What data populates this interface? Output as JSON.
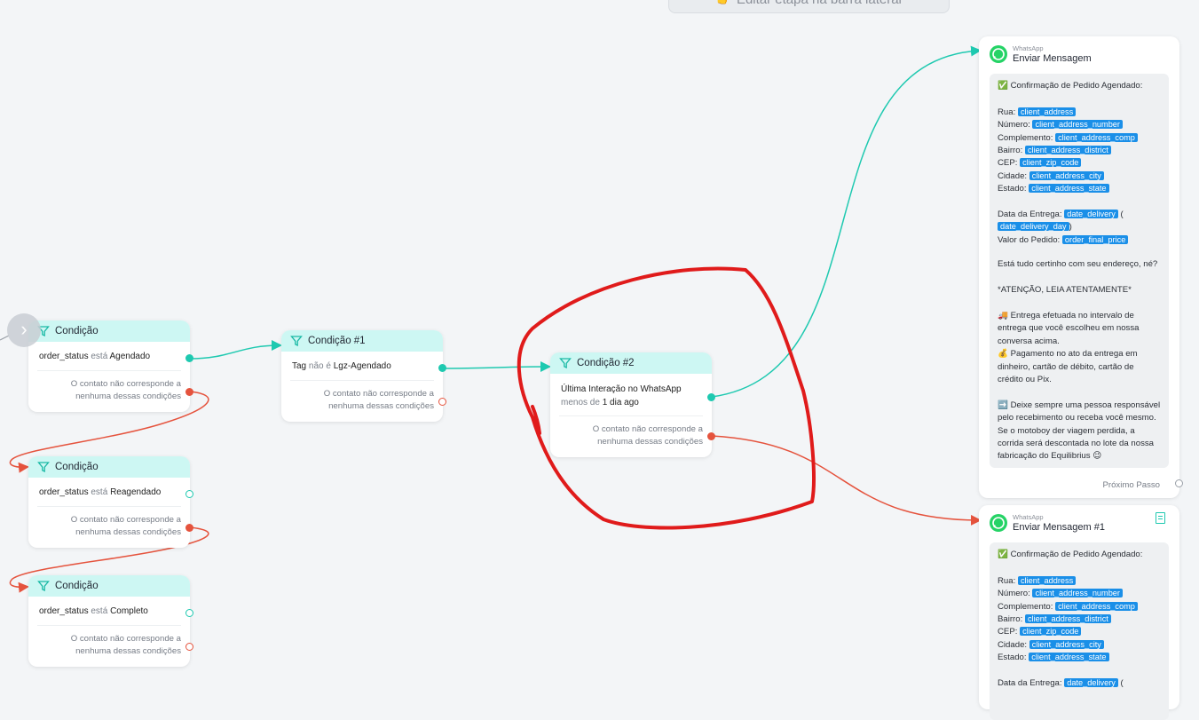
{
  "top_hint": "👉 Editar etapa na barra lateral",
  "nav_arrow": "›",
  "conditions": [
    {
      "title": "Condição",
      "field": "order_status",
      "op": "está",
      "value": "Agendado",
      "else_text": "O contato não corresponde a nenhuma dessas condições"
    },
    {
      "title": "Condição",
      "field": "order_status",
      "op": "está",
      "value": "Reagendado",
      "else_text": "O contato não corresponde a nenhuma dessas condições"
    },
    {
      "title": "Condição",
      "field": "order_status",
      "op": "está",
      "value": "Completo",
      "else_text": "O contato não corresponde a nenhuma dessas condições"
    }
  ],
  "condition1": {
    "title": "Condição #1",
    "field": "Tag",
    "op": "não é",
    "value": "Lgz-Agendado",
    "else_text": "O contato não corresponde a nenhuma dessas condições"
  },
  "condition2": {
    "title": "Condição #2",
    "field": "Última Interação no WhatsApp",
    "op": "menos de",
    "value": "1 dia ago",
    "else_text": "O contato não corresponde a nenhuma dessas condições"
  },
  "wa_cards": [
    {
      "channel": "WhatsApp",
      "title": "Enviar Mensagem",
      "next_step": "Próximo Passo",
      "icon": "whatsapp-icon"
    },
    {
      "channel": "WhatsApp",
      "title": "Enviar Mensagem #1",
      "icon": "whatsapp-icon",
      "action_icon": "notes-icon"
    }
  ],
  "message": {
    "header": "✅ Confirmação de Pedido Agendado:",
    "rua": "Rua:",
    "numero": "Número:",
    "complemento": "Complemento:",
    "bairro": "Bairro:",
    "cep": "CEP:",
    "cidade": "Cidade:",
    "estado": "Estado:",
    "data_entrega": "Data da Entrega:",
    "valor": "Valor do Pedido:",
    "open_paren": "(",
    "close_paren": ")",
    "v_address": "client_address",
    "v_number": "client_address_number",
    "v_comp": "client_address_comp",
    "v_district": "client_address_district",
    "v_zip": "client_zip_code",
    "v_city": "client_address_city",
    "v_state": "client_address_state",
    "v_date": "date_delivery",
    "v_day": "date_delivery_day",
    "v_price": "order_final_price",
    "question": "Está tudo certinho com seu endereço, né?",
    "attention": "*ATENÇÃO, LEIA ATENTAMENTE*",
    "p1_l1": "🚚 Entrega efetuada no intervalo de",
    "p1_l2": "entrega que você escolheu em nossa",
    "p1_l3": "conversa acima.",
    "p2_l1": "💰 Pagamento no ato da entrega em",
    "p2_l2": "dinheiro, cartão de débito, cartão de",
    "p2_l3": "crédito ou Pix.",
    "p3_l1": "➡️ Deixe sempre uma pessoa responsável",
    "p3_l2": "pelo recebimento ou receba você mesmo.",
    "p3_l3": "Se o motoboy der viagem perdida, a",
    "p3_l4": "corrida será descontada no lote da nossa",
    "p3_l5": "fabricação do Equilibrius 😉"
  },
  "colors": {
    "green": "#1ec9b0",
    "red": "#e5533d",
    "annotation": "#e01b1b",
    "header": "#cdf7f3",
    "chip": "#1a8fe8"
  }
}
